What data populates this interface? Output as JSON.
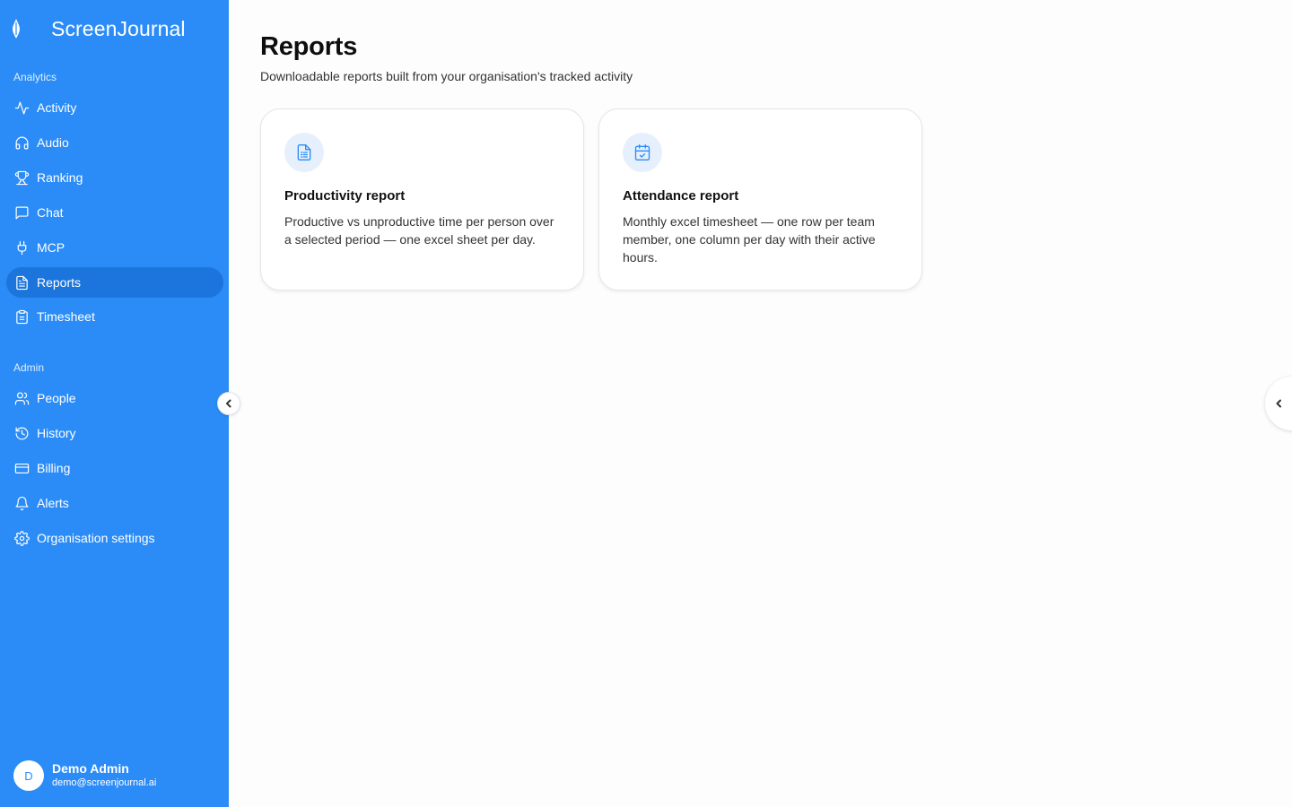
{
  "brand": {
    "name": "ScreenJournal"
  },
  "sidebar": {
    "sections": [
      {
        "label": "Analytics"
      },
      {
        "label": "Admin"
      }
    ],
    "items": [
      {
        "label": "Activity",
        "icon": "activity-icon"
      },
      {
        "label": "Audio",
        "icon": "headphones-icon"
      },
      {
        "label": "Ranking",
        "icon": "trophy-icon"
      },
      {
        "label": "Chat",
        "icon": "chat-icon"
      },
      {
        "label": "MCP",
        "icon": "plug-icon"
      },
      {
        "label": "Reports",
        "icon": "file-text-icon",
        "active": true
      },
      {
        "label": "Timesheet",
        "icon": "clipboard-icon"
      },
      {
        "label": "People",
        "icon": "users-icon"
      },
      {
        "label": "History",
        "icon": "history-icon"
      },
      {
        "label": "Billing",
        "icon": "credit-card-icon"
      },
      {
        "label": "Alerts",
        "icon": "bell-icon"
      },
      {
        "label": "Organisation settings",
        "icon": "gear-icon"
      }
    ]
  },
  "user": {
    "initial": "D",
    "name": "Demo Admin",
    "email": "demo@screenjournal.ai"
  },
  "main": {
    "title": "Reports",
    "subtitle": "Downloadable reports built from your organisation's tracked activity",
    "cards": [
      {
        "title": "Productivity report",
        "description": "Productive vs unproductive time per person over a selected period — one excel sheet per day.",
        "icon": "document-icon"
      },
      {
        "title": "Attendance report",
        "description": "Monthly excel timesheet — one row per team member, one column per day with their active hours.",
        "icon": "calendar-check-icon"
      }
    ]
  },
  "colors": {
    "sidebar": "#2b8cf7",
    "active": "#1c75dc",
    "background": "#fdfdfe",
    "icon_bg": "#e6f0fd"
  }
}
